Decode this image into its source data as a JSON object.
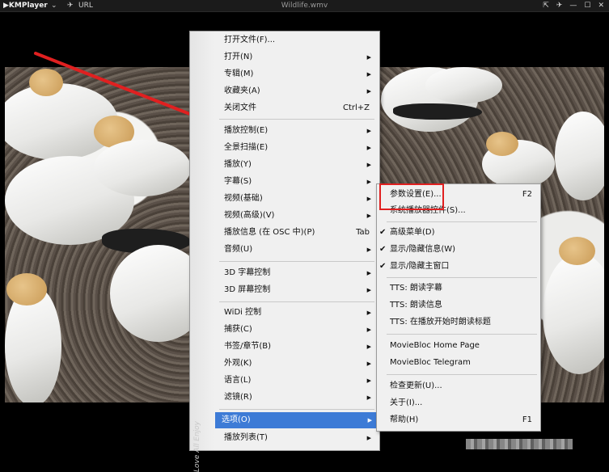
{
  "titlebar": {
    "app_name": "KMPlayer",
    "chevron": "⌄",
    "pin": "✈",
    "url_label": "URL",
    "file_title": "Wildlife.wmv",
    "window_controls": [
      "⇱",
      "✈",
      "—",
      "☐",
      "✕"
    ]
  },
  "menu": {
    "watermark": "Love All Enjoy",
    "items": [
      {
        "label": "打开文件(F)...",
        "shortcut": "",
        "submenu": false
      },
      {
        "label": "打开(N)",
        "shortcut": "",
        "submenu": true
      },
      {
        "label": "专辑(M)",
        "shortcut": "",
        "submenu": true
      },
      {
        "label": "收藏夹(A)",
        "shortcut": "",
        "submenu": true
      },
      {
        "label": "关闭文件",
        "shortcut": "Ctrl+Z",
        "submenu": false
      },
      {
        "label": "播放控制(E)",
        "shortcut": "",
        "submenu": true
      },
      {
        "label": "全景扫描(E)",
        "shortcut": "",
        "submenu": true
      },
      {
        "label": "播放(Y)",
        "shortcut": "",
        "submenu": true
      },
      {
        "label": "字幕(S)",
        "shortcut": "",
        "submenu": true
      },
      {
        "label": "视频(基础)",
        "shortcut": "",
        "submenu": true
      },
      {
        "label": "视频(高级)(V)",
        "shortcut": "",
        "submenu": true
      },
      {
        "label": "播放信息 (在 OSC 中)(P)",
        "shortcut": "Tab",
        "submenu": false
      },
      {
        "label": "音频(U)",
        "shortcut": "",
        "submenu": true
      },
      {
        "label": "3D 字幕控制",
        "shortcut": "",
        "submenu": true
      },
      {
        "label": "3D 屏幕控制",
        "shortcut": "",
        "submenu": true
      },
      {
        "label": "WiDi 控制",
        "shortcut": "",
        "submenu": true
      },
      {
        "label": "捕获(C)",
        "shortcut": "",
        "submenu": true
      },
      {
        "label": "书签/章节(B)",
        "shortcut": "",
        "submenu": true
      },
      {
        "label": "外观(K)",
        "shortcut": "",
        "submenu": true
      },
      {
        "label": "语言(L)",
        "shortcut": "",
        "submenu": true
      },
      {
        "label": "滤镜(R)",
        "shortcut": "",
        "submenu": true
      },
      {
        "label": "选项(O)",
        "shortcut": "",
        "submenu": true,
        "highlighted": true
      },
      {
        "label": "播放列表(T)",
        "shortcut": "",
        "submenu": true
      }
    ]
  },
  "submenu": {
    "items": [
      {
        "label": "参数设置(E)...",
        "shortcut": "F2",
        "checked": false
      },
      {
        "label": "系统播放器控件(S)...",
        "shortcut": "",
        "checked": false
      },
      {
        "label": "高级菜单(D)",
        "shortcut": "",
        "checked": true
      },
      {
        "label": "显示/隐藏信息(W)",
        "shortcut": "",
        "checked": true
      },
      {
        "label": "显示/隐藏主窗口",
        "shortcut": "",
        "checked": true
      },
      {
        "label": "TTS: 朗读字幕",
        "shortcut": "",
        "checked": false
      },
      {
        "label": "TTS: 朗读信息",
        "shortcut": "",
        "checked": false
      },
      {
        "label": "TTS: 在播放开始时朗读标题",
        "shortcut": "",
        "checked": false
      },
      {
        "label": "MovieBloc Home Page",
        "shortcut": "",
        "checked": false
      },
      {
        "label": "MovieBloc Telegram",
        "shortcut": "",
        "checked": false
      },
      {
        "label": "检查更新(U)...",
        "shortcut": "",
        "checked": false
      },
      {
        "label": "关于(I)...",
        "shortcut": "",
        "checked": false
      },
      {
        "label": "帮助(H)",
        "shortcut": "F1",
        "checked": false
      }
    ]
  },
  "colors": {
    "highlight": "#3d7bd6",
    "annotation": "#e02020",
    "menu_bg": "#f0f0f0"
  },
  "icons": {
    "submenu_arrow": "▶",
    "checkmark": "✔"
  }
}
